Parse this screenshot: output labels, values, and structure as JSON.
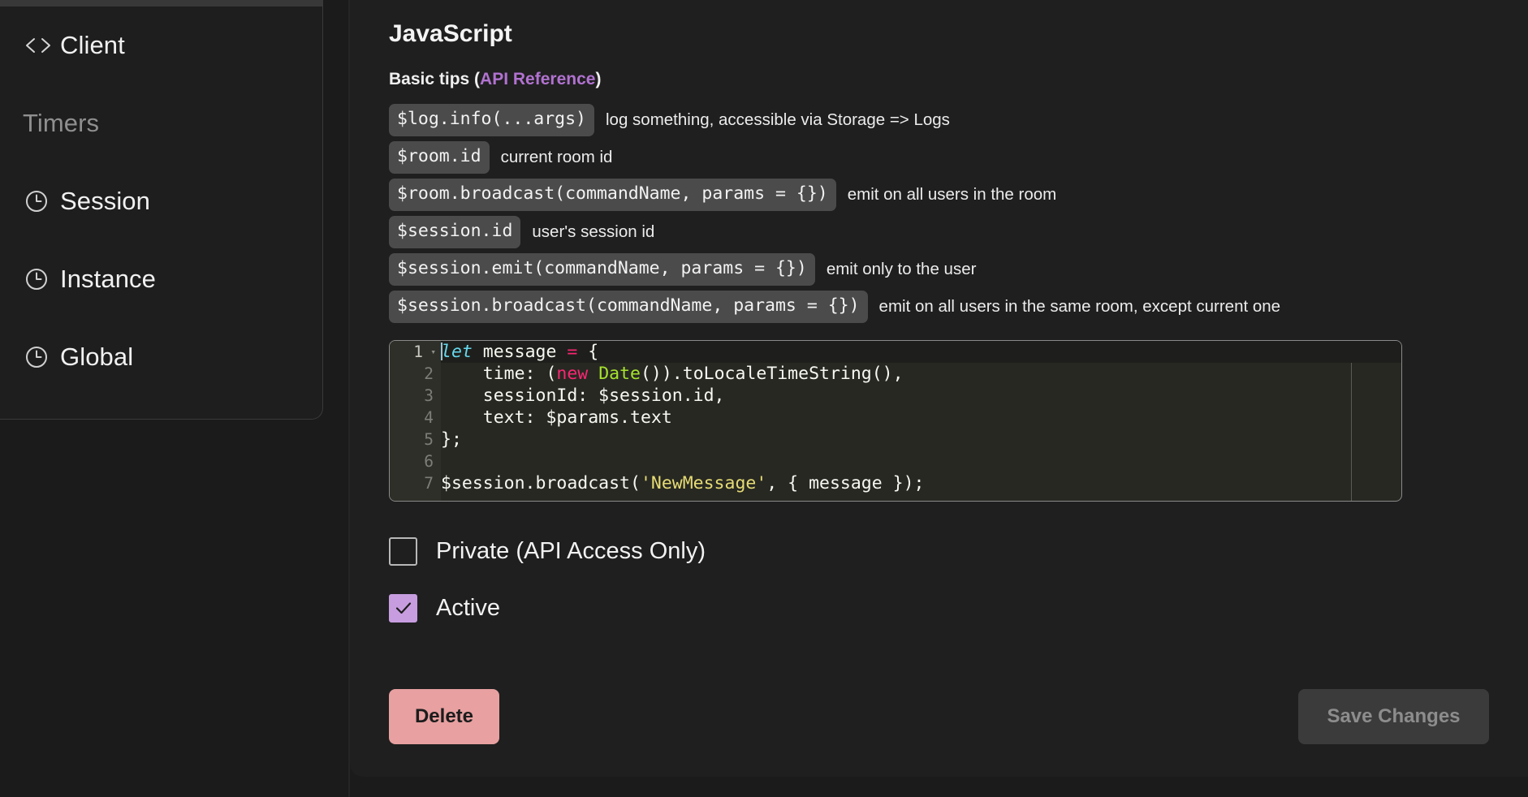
{
  "sidebar": {
    "items": [
      {
        "label": "Client",
        "icon": "code-brackets-icon",
        "type": "item"
      },
      {
        "label": "Timers",
        "icon": "none",
        "type": "section"
      },
      {
        "label": "Session",
        "icon": "clock-icon",
        "type": "item"
      },
      {
        "label": "Instance",
        "icon": "clock-icon",
        "type": "item"
      },
      {
        "label": "Global",
        "icon": "clock-icon",
        "type": "item"
      }
    ]
  },
  "main": {
    "title": "JavaScript",
    "tips_heading_prefix": "Basic tips (",
    "tips_heading_link": "API Reference",
    "tips_heading_suffix": ")",
    "tips": [
      {
        "code": "$log.info(...args)",
        "desc": "log something, accessible via Storage => Logs"
      },
      {
        "code": "$room.id",
        "desc": "current room id"
      },
      {
        "code": "$room.broadcast(commandName, params = {})",
        "desc": "emit on all users in the room"
      },
      {
        "code": "$session.id",
        "desc": "user's session id"
      },
      {
        "code": "$session.emit(commandName, params = {})",
        "desc": "emit only to the user"
      },
      {
        "code": "$session.broadcast(commandName, params = {})",
        "desc": "emit on all users in the same room, except current one"
      }
    ],
    "editor": {
      "language": "javascript",
      "line_numbers": [
        "1",
        "2",
        "3",
        "4",
        "5",
        "6",
        "7"
      ],
      "lines": [
        "let message = {",
        "    time: (new Date()).toLocaleTimeString(),",
        "    sessionId: $session.id,",
        "    text: $params.text",
        "};",
        "",
        "$session.broadcast('NewMessage', { message });"
      ],
      "active_line": "1",
      "fold_marker": "▾"
    },
    "checkboxes": [
      {
        "label": "Private (API Access Only)",
        "checked": false
      },
      {
        "label": "Active",
        "checked": true
      }
    ],
    "check_mark": "✓",
    "delete_label": "Delete",
    "save_label": "Save Changes"
  },
  "colors": {
    "accent_link": "#b172d0",
    "checkbox_checked": "#c79de0",
    "delete_button": "#e8a0a0",
    "save_button_disabled_bg": "#3b3b3b",
    "save_button_disabled_text": "#8d8d8d",
    "panel_bg": "#1f1f1f",
    "sidebar_bg": "#1e1e1e",
    "editor_bg": "#272822",
    "chip_bg": "#4b4b4b",
    "syntax_keyword": "#66d9ef",
    "syntax_operator": "#f92672",
    "syntax_type": "#a6e22e",
    "syntax_string": "#e6db74",
    "syntax_plain": "#f8f8f2"
  }
}
